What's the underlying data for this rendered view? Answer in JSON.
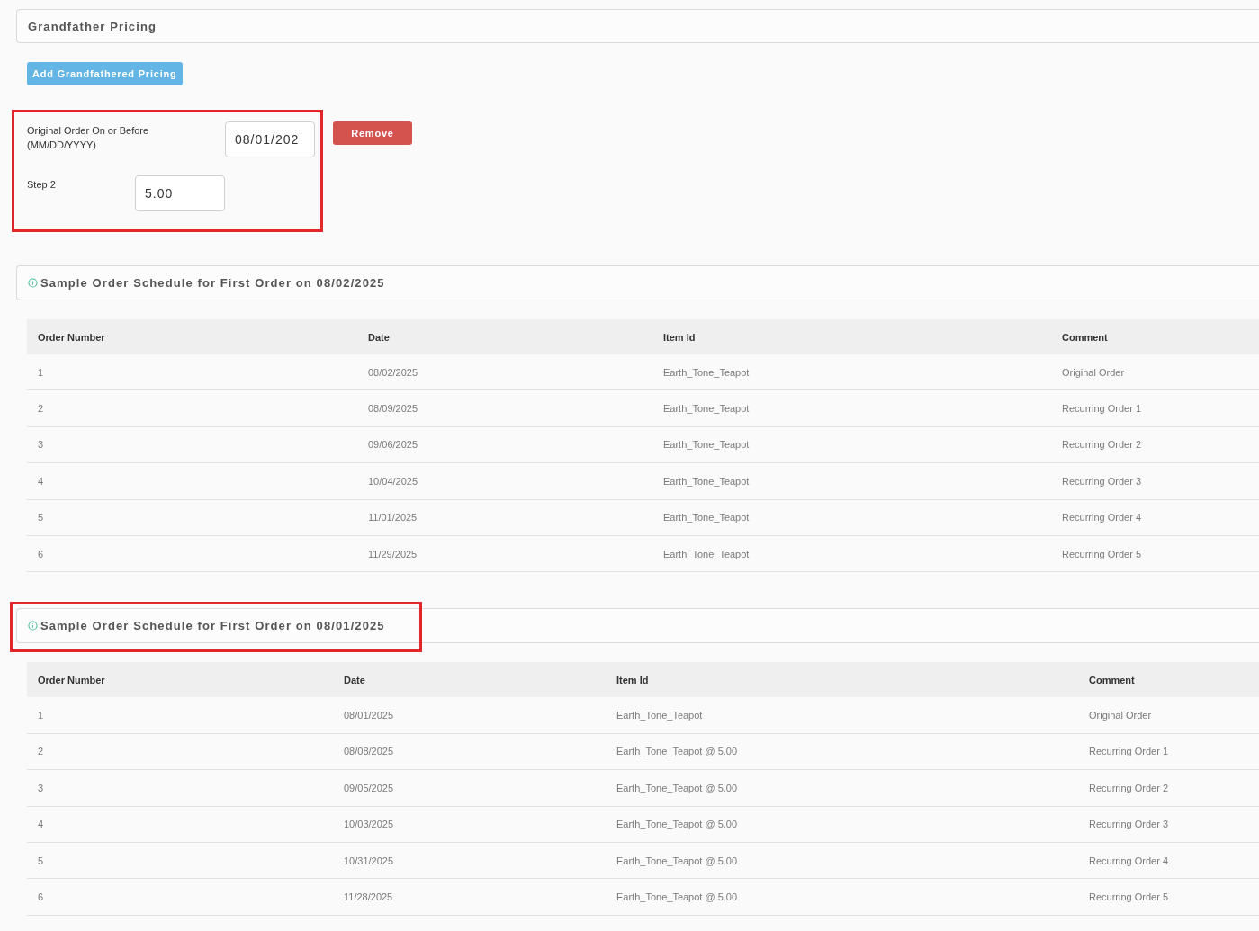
{
  "panel": {
    "title": "Grandfather Pricing"
  },
  "add_button": "Add Grandfathered Pricing",
  "pricing_entry": {
    "highlighted": true,
    "fields": [
      {
        "label": "Original Order On or Before (MM/DD/YYYY)",
        "value": "08/01/202"
      },
      {
        "label": "Step 2",
        "value": "5.00"
      }
    ],
    "remove_button": "Remove"
  },
  "schedules": [
    {
      "title": "Sample Order Schedule for First Order on 08/02/2025",
      "highlighted": false,
      "columns": [
        "Order Number",
        "Date",
        "Item Id",
        "Comment"
      ],
      "rows": [
        [
          "1",
          "08/02/2025",
          "Earth_Tone_Teapot",
          "Original Order"
        ],
        [
          "2",
          "08/09/2025",
          "Earth_Tone_Teapot",
          "Recurring Order 1"
        ],
        [
          "3",
          "09/06/2025",
          "Earth_Tone_Teapot",
          "Recurring Order 2"
        ],
        [
          "4",
          "10/04/2025",
          "Earth_Tone_Teapot",
          "Recurring Order 3"
        ],
        [
          "5",
          "11/01/2025",
          "Earth_Tone_Teapot",
          "Recurring Order 4"
        ],
        [
          "6",
          "11/29/2025",
          "Earth_Tone_Teapot",
          "Recurring Order 5"
        ]
      ]
    },
    {
      "title": "Sample Order Schedule for First Order on 08/01/2025",
      "highlighted": true,
      "columns": [
        "Order Number",
        "Date",
        "Item Id",
        "Comment"
      ],
      "rows": [
        [
          "1",
          "08/01/2025",
          "Earth_Tone_Teapot",
          "Original Order"
        ],
        [
          "2",
          "08/08/2025",
          "Earth_Tone_Teapot @ 5.00",
          "Recurring Order 1"
        ],
        [
          "3",
          "09/05/2025",
          "Earth_Tone_Teapot @ 5.00",
          "Recurring Order 2"
        ],
        [
          "4",
          "10/03/2025",
          "Earth_Tone_Teapot @ 5.00",
          "Recurring Order 3"
        ],
        [
          "5",
          "10/31/2025",
          "Earth_Tone_Teapot @ 5.00",
          "Recurring Order 4"
        ],
        [
          "6",
          "11/28/2025",
          "Earth_Tone_Teapot @ 5.00",
          "Recurring Order 5"
        ]
      ]
    }
  ]
}
